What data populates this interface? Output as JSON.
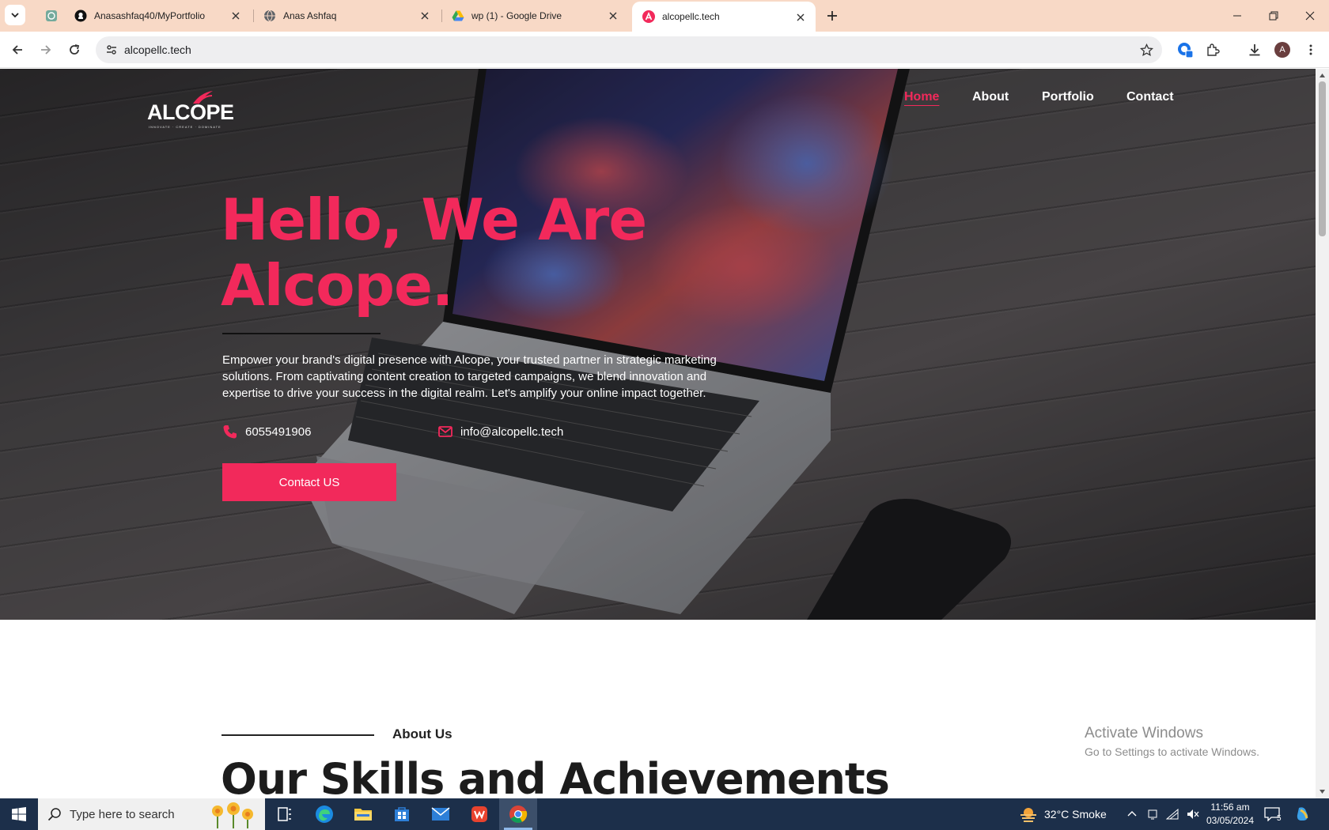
{
  "browser": {
    "tabs": [
      {
        "title": "",
        "icon": "chatgpt-icon"
      },
      {
        "title": "Anasashfaq40/MyPortfolio",
        "icon": "github-icon"
      },
      {
        "title": "Anas Ashfaq",
        "icon": "globe-icon"
      },
      {
        "title": "wp (1) - Google Drive",
        "icon": "google-drive-icon"
      },
      {
        "title": "alcopellc.tech",
        "icon": "alcope-icon",
        "active": true
      }
    ],
    "url": "alcopellc.tech",
    "profile_initial": "A"
  },
  "site": {
    "logo_text": "ALCOPE",
    "logo_tagline": "INNOVATE · CREATE · DOMINATE",
    "nav": [
      "Home",
      "About",
      "Portfolio",
      "Contact"
    ],
    "nav_active": "Home",
    "hero": {
      "title_line1": "Hello, We Are",
      "title_line2": "Alcope.",
      "description": "Empower your brand's digital presence with Alcope, your trusted partner in strategic marketing solutions. From captivating content creation to targeted campaigns, we blend innovation and expertise to drive your success in the digital realm. Let's amplify your online impact together.",
      "phone": "6055491906",
      "email": "info@alcopellc.tech",
      "cta": "Contact US"
    },
    "about": {
      "kicker": "About Us",
      "title": "Our Skills and Achievements"
    }
  },
  "watermark": {
    "title": "Activate Windows",
    "subtitle": "Go to Settings to activate Windows."
  },
  "taskbar": {
    "search_placeholder": "Type here to search",
    "weather": "32°C  Smoke",
    "time": "11:56 am",
    "date": "03/05/2024",
    "notification_count": "5"
  },
  "colors": {
    "accent": "#f2295b",
    "tabstrip": "#f8d9c6",
    "taskbar": "#1c2f4a"
  }
}
